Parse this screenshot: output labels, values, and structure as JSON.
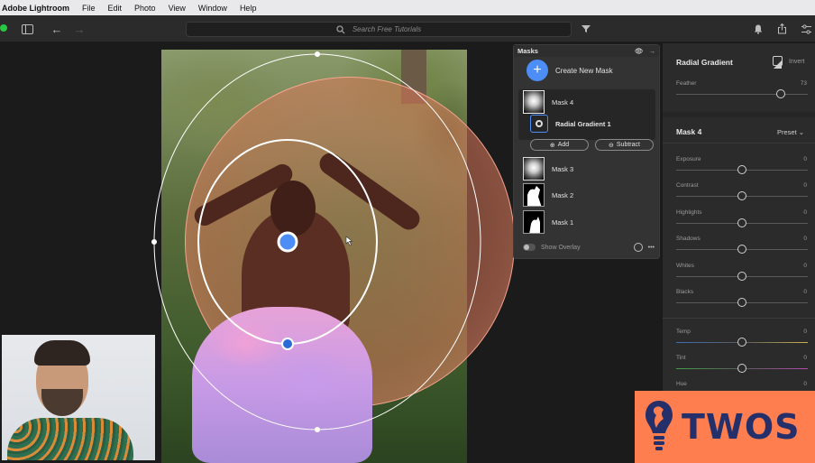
{
  "menubar": {
    "app_name": "Adobe Lightroom",
    "items": [
      "File",
      "Edit",
      "Photo",
      "View",
      "Window",
      "Help"
    ]
  },
  "toolbar": {
    "search_placeholder": "Search Free Tutorials"
  },
  "masks_panel": {
    "title": "Masks",
    "create_label": "Create New Mask",
    "masks": [
      {
        "label": "Mask 4",
        "selected": true
      },
      {
        "label": "Mask 3"
      },
      {
        "label": "Mask 2"
      },
      {
        "label": "Mask 1"
      }
    ],
    "submask_label": "Radial Gradient 1",
    "add_label": "Add",
    "subtract_label": "Subtract",
    "show_overlay_label": "Show Overlay",
    "more_label": "•••"
  },
  "edit_panel": {
    "tool_title": "Radial Gradient",
    "invert_label": "Invert",
    "feather_label": "Feather",
    "feather_value": "73",
    "mask_title": "Mask 4",
    "preset_label": "Preset",
    "sliders": [
      {
        "label": "Exposure",
        "value": "0"
      },
      {
        "label": "Contrast",
        "value": "0"
      },
      {
        "label": "Highlights",
        "value": "0"
      },
      {
        "label": "Shadows",
        "value": "0"
      },
      {
        "label": "Whites",
        "value": "0"
      },
      {
        "label": "Blacks",
        "value": "0"
      },
      {
        "label": "Temp",
        "value": "0"
      },
      {
        "label": "Tint",
        "value": "0"
      },
      {
        "label": "Hue",
        "value": "0"
      }
    ]
  },
  "watermark": {
    "text": "TWOS"
  },
  "colors": {
    "accent_blue": "#4c8ef5",
    "watermark_orange": "#ff7e4f",
    "watermark_navy": "#25306b"
  }
}
